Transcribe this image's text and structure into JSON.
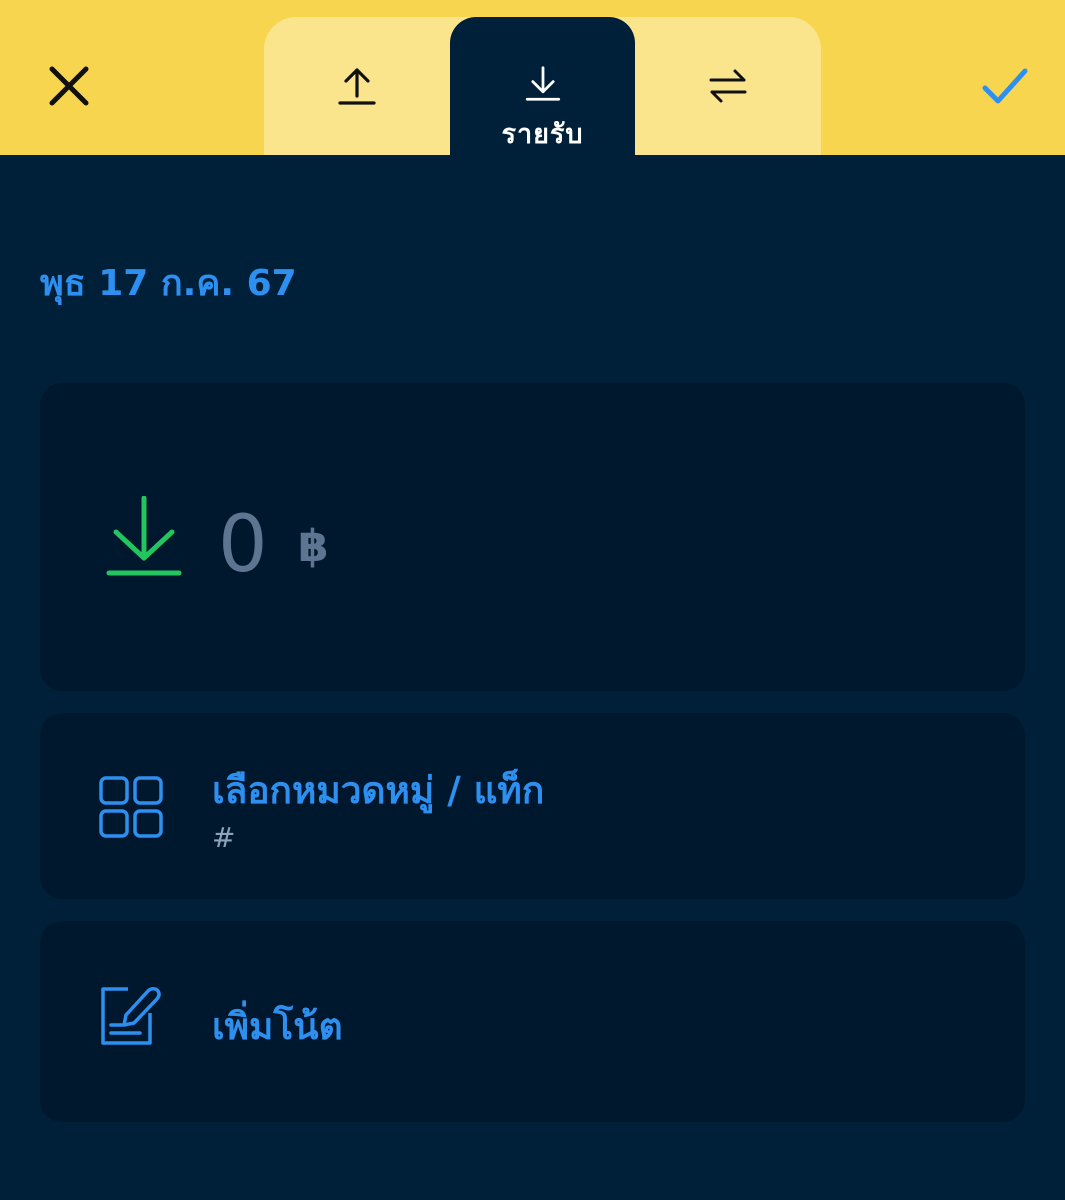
{
  "header": {
    "close_icon": "close-icon",
    "confirm_icon": "checkmark-icon",
    "accent_color": "#2d8ff0",
    "background_color": "#f8d54f"
  },
  "tabs": [
    {
      "id": "expense",
      "icon": "upload-arrow-icon",
      "label": ""
    },
    {
      "id": "income",
      "icon": "download-arrow-icon",
      "label": "รายรับ",
      "selected": true
    },
    {
      "id": "transfer",
      "icon": "swap-arrows-icon",
      "label": ""
    }
  ],
  "date": {
    "label": "พุธ 17 ก.ค. 67"
  },
  "amount": {
    "icon": "income-download-icon",
    "value": "0",
    "currency": "฿",
    "icon_color": "#22c55e"
  },
  "category": {
    "icon": "grid-icon",
    "title": "เลือกหมวดหมู่ / แท็ก",
    "hint": "#"
  },
  "note": {
    "icon": "note-edit-icon",
    "title": "เพิ่มโน้ต"
  }
}
